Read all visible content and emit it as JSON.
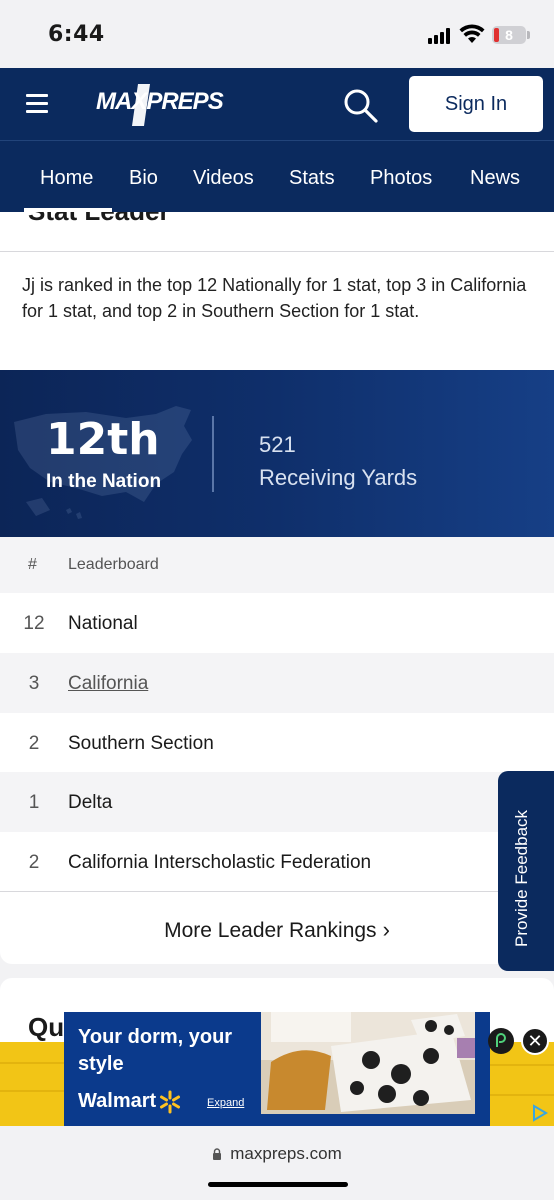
{
  "status_bar": {
    "time": "6:44",
    "battery": "8"
  },
  "header": {
    "logo": "MAXPREPS",
    "sign_in": "Sign In"
  },
  "nav": {
    "tabs": [
      "Home",
      "Bio",
      "Videos",
      "Stats",
      "Photos",
      "News"
    ],
    "active": "Home"
  },
  "card": {
    "title": "Stat Leader",
    "summary": "Jj is ranked in the top 12 Nationally for 1 stat, top 3 in California for 1 stat, and top 2 in Southern Section for 1 stat."
  },
  "rank_banner": {
    "rank": "12th",
    "rank_label": "In the Nation",
    "stat_value": "521",
    "stat_label": "Receiving Yards"
  },
  "leaderboard": {
    "headers": [
      "#",
      "Leaderboard"
    ],
    "rows": [
      {
        "rank": "12",
        "name": "National"
      },
      {
        "rank": "3",
        "name": "California"
      },
      {
        "rank": "2",
        "name": "Southern Section"
      },
      {
        "rank": "1",
        "name": "Delta"
      },
      {
        "rank": "2",
        "name": "California Interscholastic Federation"
      }
    ],
    "more_label": "More Leader Rankings"
  },
  "next_card": {
    "title_partial": "Qu"
  },
  "feedback": {
    "label": "Provide Feedback"
  },
  "ad": {
    "headline": "Your dorm, your style",
    "brand": "Walmart",
    "expand": "Expand",
    "colors": {
      "strip": "#f2c516",
      "box": "#0b3a8c",
      "spark": "#ffc220"
    }
  },
  "url_bar": {
    "url": "maxpreps.com"
  },
  "colors": {
    "brand_navy": "#0b2a5e",
    "battery_red": "#e0302f"
  }
}
